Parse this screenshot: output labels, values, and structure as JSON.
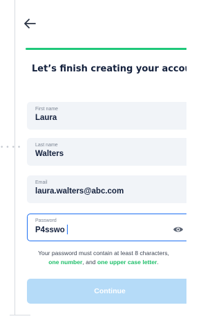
{
  "header": {
    "back_icon": "arrow-left-icon",
    "progress_fraction": 1.0,
    "progress_color": "#1fc87a"
  },
  "title": "Let’s finish creating your account.",
  "form": {
    "first_name": {
      "label": "First name",
      "value": "Laura"
    },
    "last_name": {
      "label": "Last name",
      "value": "Walters"
    },
    "email": {
      "label": "Email",
      "value": "laura.walters@abc.com"
    },
    "password": {
      "label": "Password",
      "value": "P4sswo",
      "toggle_icon": "eye-icon"
    }
  },
  "helper": {
    "part1": "Your password must contain at least 8 characters,",
    "req1": "one number",
    "part2": ", and ",
    "req2": "one upper case letter",
    "part3": "."
  },
  "continue_label": "Continue",
  "colors": {
    "accent_green": "#1fc87a",
    "focus_blue": "#1d6ff2",
    "button_disabled": "#b5dbf8",
    "text_dark": "#14213d"
  }
}
